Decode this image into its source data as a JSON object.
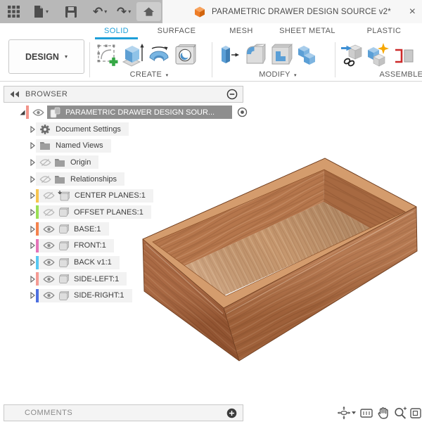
{
  "topbar": {
    "document_tab": {
      "title": "PARAMETRIC DRAWER DESIGN SOURCE v2*",
      "close_label": "×"
    },
    "icons": [
      "app-grid",
      "new-document",
      "save",
      "undo",
      "redo",
      "home"
    ]
  },
  "ribbon": {
    "design_menu": {
      "label": "DESIGN"
    },
    "active_tab_color": "#1e9fd8",
    "tabs": [
      {
        "label": "SOLID",
        "active": true
      },
      {
        "label": "SURFACE",
        "active": false
      },
      {
        "label": "MESH",
        "active": false
      },
      {
        "label": "SHEET METAL",
        "active": false
      },
      {
        "label": "PLASTIC",
        "active": false
      }
    ],
    "groups": [
      {
        "label": "CREATE",
        "tools": [
          "create-sketch",
          "extrude",
          "revolve",
          "hole"
        ]
      },
      {
        "label": "MODIFY",
        "tools": [
          "press-pull",
          "fillet",
          "shell",
          "combine"
        ]
      },
      {
        "label": "ASSEMBLE",
        "tools": [
          "insert-derive",
          "new-component",
          "joint"
        ]
      }
    ]
  },
  "browser": {
    "title": "BROWSER",
    "collapse_icon": "minus-circle",
    "root": {
      "label": "PARAMETRIC DRAWER DESIGN SOUR...",
      "bar_color": "#f2948a",
      "eye": "visible",
      "selected": true
    },
    "items": [
      {
        "label": "Document Settings",
        "icon": "gear",
        "eye": null,
        "bar_color": null
      },
      {
        "label": "Named Views",
        "icon": "folder",
        "eye": null,
        "bar_color": null
      },
      {
        "label": "Origin",
        "icon": "folder",
        "eye": "hidden",
        "bar_color": null
      },
      {
        "label": "Relationships",
        "icon": "folder",
        "eye": "hidden",
        "bar_color": null
      },
      {
        "label": "CENTER PLANES:1",
        "icon": "component-pinned",
        "eye": "hidden",
        "bar_color": "#f7c54f"
      },
      {
        "label": "OFFSET PLANES:1",
        "icon": "component",
        "eye": "hidden",
        "bar_color": "#9bdf55"
      },
      {
        "label": "BASE:1",
        "icon": "component",
        "eye": "visible",
        "bar_color": "#f5834e"
      },
      {
        "label": "FRONT:1",
        "icon": "component",
        "eye": "visible",
        "bar_color": "#e473b8"
      },
      {
        "label": "BACK v1:1",
        "icon": "component",
        "eye": "visible",
        "bar_color": "#57c8f2"
      },
      {
        "label": "SIDE-LEFT:1",
        "icon": "component",
        "eye": "visible",
        "bar_color": "#f59b94"
      },
      {
        "label": "SIDE-RIGHT:1",
        "icon": "component",
        "eye": "visible",
        "bar_color": "#4d6fe0"
      }
    ]
  },
  "viewport": {
    "model_name": "wooden drawer box",
    "wood_colors": {
      "outer_front": "#ae6c42",
      "outer_left": "#a5613a",
      "rim_top": "#d49c6d",
      "floor": "#c7986f",
      "inner_wall_left": "#b5764c",
      "inner_wall_right": "#a76941",
      "edge_line": "#6f3e20"
    }
  },
  "comments_bar": {
    "label": "COMMENTS",
    "add_icon": "plus-circle"
  },
  "nav_toolbar": {
    "icons": [
      "orbit",
      "look-at",
      "pan",
      "zoom",
      "fit-window"
    ]
  }
}
